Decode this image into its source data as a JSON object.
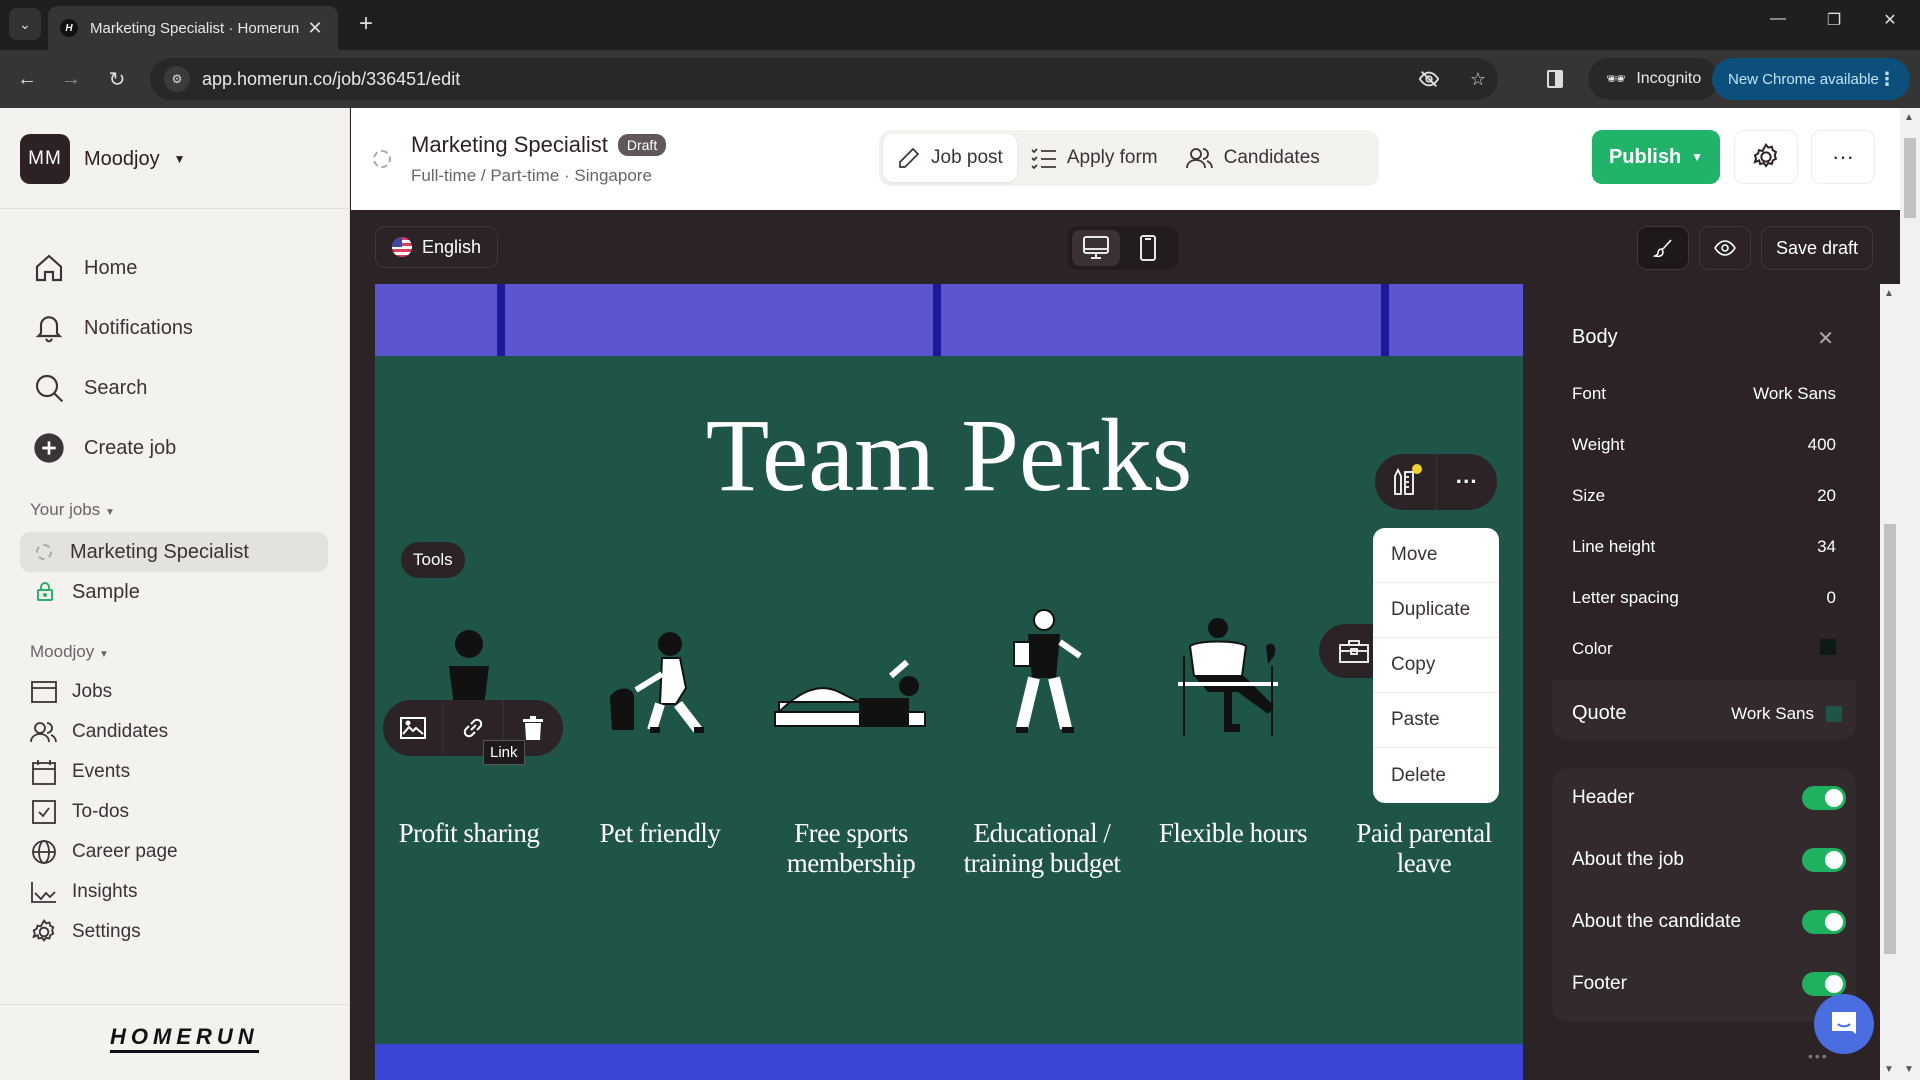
{
  "browser": {
    "tab_title": "Marketing Specialist · Homerun",
    "url": "app.homerun.co/job/336451/edit",
    "incognito_label": "Incognito",
    "update_label": "New Chrome available"
  },
  "sidebar": {
    "workspace_initials": "MM",
    "workspace_name": "Moodjoy",
    "main_nav": [
      {
        "label": "Home",
        "icon": "home-icon"
      },
      {
        "label": "Notifications",
        "icon": "bell-icon"
      },
      {
        "label": "Search",
        "icon": "search-icon"
      },
      {
        "label": "Create job",
        "icon": "plus-circle-icon"
      }
    ],
    "your_jobs_label": "Your jobs",
    "jobs": [
      {
        "label": "Marketing Specialist",
        "icon": "draft-status-icon",
        "active": true
      },
      {
        "label": "Sample",
        "icon": "lock-icon",
        "active": false
      }
    ],
    "workspace_section_label": "Moodjoy",
    "workspace_nav": [
      {
        "label": "Jobs",
        "icon": "jobs-icon"
      },
      {
        "label": "Candidates",
        "icon": "people-icon"
      },
      {
        "label": "Events",
        "icon": "calendar-icon"
      },
      {
        "label": "To-dos",
        "icon": "checkbox-icon"
      },
      {
        "label": "Career page",
        "icon": "globe-icon"
      },
      {
        "label": "Insights",
        "icon": "chart-icon"
      },
      {
        "label": "Settings",
        "icon": "gear-icon"
      }
    ],
    "brand": "HOMERUN"
  },
  "job_header": {
    "title": "Marketing Specialist",
    "status_badge": "Draft",
    "subtitle": "Full-time / Part-time · Singapore",
    "tabs": [
      {
        "label": "Job post",
        "active": true
      },
      {
        "label": "Apply form",
        "active": false
      },
      {
        "label": "Candidates",
        "active": false
      }
    ],
    "publish_label": "Publish"
  },
  "editor_toolbar": {
    "language": "English",
    "device": "desktop",
    "save_draft_label": "Save draft"
  },
  "canvas": {
    "section_title": "Team Perks",
    "tools_chip": "Tools",
    "tooltip": "Link",
    "perks": [
      "Profit sharing",
      "Pet friendly",
      "Free sports membership",
      "Educational / training budget",
      "Flexible hours",
      "Paid parental leave"
    ],
    "context_menu": [
      "Move",
      "Duplicate",
      "Copy",
      "Paste",
      "Delete"
    ],
    "colors": {
      "top_band": "#5c55d0",
      "perks_bg": "#1f5449",
      "bottom_band": "#3c45d6"
    }
  },
  "style_panel": {
    "section": "Body",
    "properties": [
      {
        "label": "Font",
        "value": "Work Sans"
      },
      {
        "label": "Weight",
        "value": "400"
      },
      {
        "label": "Size",
        "value": "20"
      },
      {
        "label": "Line height",
        "value": "34"
      },
      {
        "label": "Letter spacing",
        "value": "0"
      },
      {
        "label": "Color",
        "value": "",
        "swatch": "#0d1a16"
      }
    ],
    "quote": {
      "label": "Quote",
      "value": "Work Sans",
      "swatch": "#1f5449"
    },
    "sections": [
      {
        "label": "Header",
        "enabled": true
      },
      {
        "label": "About the job",
        "enabled": true
      },
      {
        "label": "About the candidate",
        "enabled": true
      },
      {
        "label": "Footer",
        "enabled": true
      }
    ]
  },
  "accent": {
    "publish": "#22b36b",
    "toggle_on": "#1fb060",
    "chat": "#4a6ee0"
  }
}
